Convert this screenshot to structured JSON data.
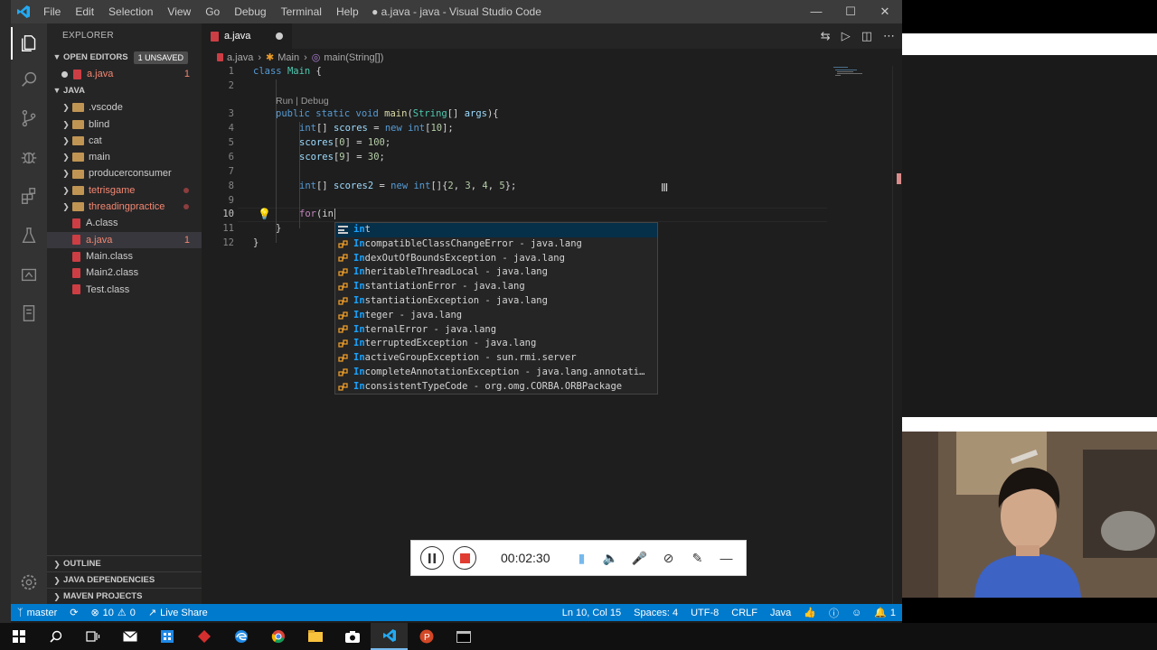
{
  "window": {
    "title": "● a.java - java - Visual Studio Code",
    "menu": [
      "File",
      "Edit",
      "Selection",
      "View",
      "Go",
      "Debug",
      "Terminal",
      "Help"
    ]
  },
  "sidebar": {
    "header": "EXPLORER",
    "open_editors": {
      "label": "OPEN EDITORS",
      "badge": "1 UNSAVED",
      "file": "a.java",
      "errors": "1"
    },
    "root_label": "JAVA",
    "items": [
      {
        "label": "vscode",
        "display": ".vscode"
      },
      {
        "label": "blind"
      },
      {
        "label": "cat"
      },
      {
        "label": "main"
      },
      {
        "label": "producerconsumer"
      },
      {
        "label": "tetrisgame"
      },
      {
        "label": "threadingpractice"
      },
      {
        "label": "A.class"
      },
      {
        "label": "a.java",
        "errors": "1"
      },
      {
        "label": "Main.class"
      },
      {
        "label": "Main2.class"
      },
      {
        "label": "Test.class"
      }
    ],
    "bottom_sections": [
      "OUTLINE",
      "JAVA DEPENDENCIES",
      "MAVEN PROJECTS"
    ]
  },
  "tab": {
    "label": "a.java"
  },
  "breadcrumb": [
    "a.java",
    "Main",
    "main(String[])"
  ],
  "editor": {
    "codelens": "Run | Debug",
    "line_numbers": [
      "1",
      "2",
      "3",
      "4",
      "5",
      "6",
      "7",
      "8",
      "9",
      "10",
      "11",
      "12"
    ],
    "lines": [
      "class Main {",
      "",
      "public static void main(String[] args){",
      "int[] scores = new int[10];",
      "scores[0] = 100;",
      "scores[9] = 30;",
      "",
      "int[] scores2 = new int[]{2, 3, 4, 5};",
      "",
      "for(in",
      "}",
      "}"
    ]
  },
  "suggestions": [
    {
      "match": "in",
      "rest": "t",
      "kind": "keyword"
    },
    {
      "match": "In",
      "rest": "compatibleClassChangeError - java.lang",
      "kind": "class"
    },
    {
      "match": "In",
      "rest": "dexOutOfBoundsException - java.lang",
      "kind": "class"
    },
    {
      "match": "In",
      "rest": "heritableThreadLocal - java.lang",
      "kind": "class"
    },
    {
      "match": "In",
      "rest": "stantiationError - java.lang",
      "kind": "class"
    },
    {
      "match": "In",
      "rest": "stantiationException - java.lang",
      "kind": "class"
    },
    {
      "match": "In",
      "rest": "teger - java.lang",
      "kind": "class"
    },
    {
      "match": "In",
      "rest": "ternalError - java.lang",
      "kind": "class"
    },
    {
      "match": "In",
      "rest": "terruptedException - java.lang",
      "kind": "class"
    },
    {
      "match": "In",
      "rest": "activeGroupException - sun.rmi.server",
      "kind": "class"
    },
    {
      "match": "In",
      "rest": "completeAnnotationException - java.lang.annotati…",
      "kind": "class"
    },
    {
      "match": "In",
      "rest": "consistentTypeCode - org.omg.CORBA.ORBPackage",
      "kind": "class"
    }
  ],
  "statusbar": {
    "branch": "master",
    "errors": "10",
    "warnings": "0",
    "live_share": "Live Share",
    "position": "Ln 10, Col 15",
    "spaces": "Spaces: 4",
    "encoding": "UTF-8",
    "eol": "CRLF",
    "language": "Java",
    "notifications": "1"
  },
  "recorder": {
    "time": "00:02:30"
  },
  "colors": {
    "accent": "#007acc",
    "error": "#f48771",
    "record": "#e03c31"
  }
}
